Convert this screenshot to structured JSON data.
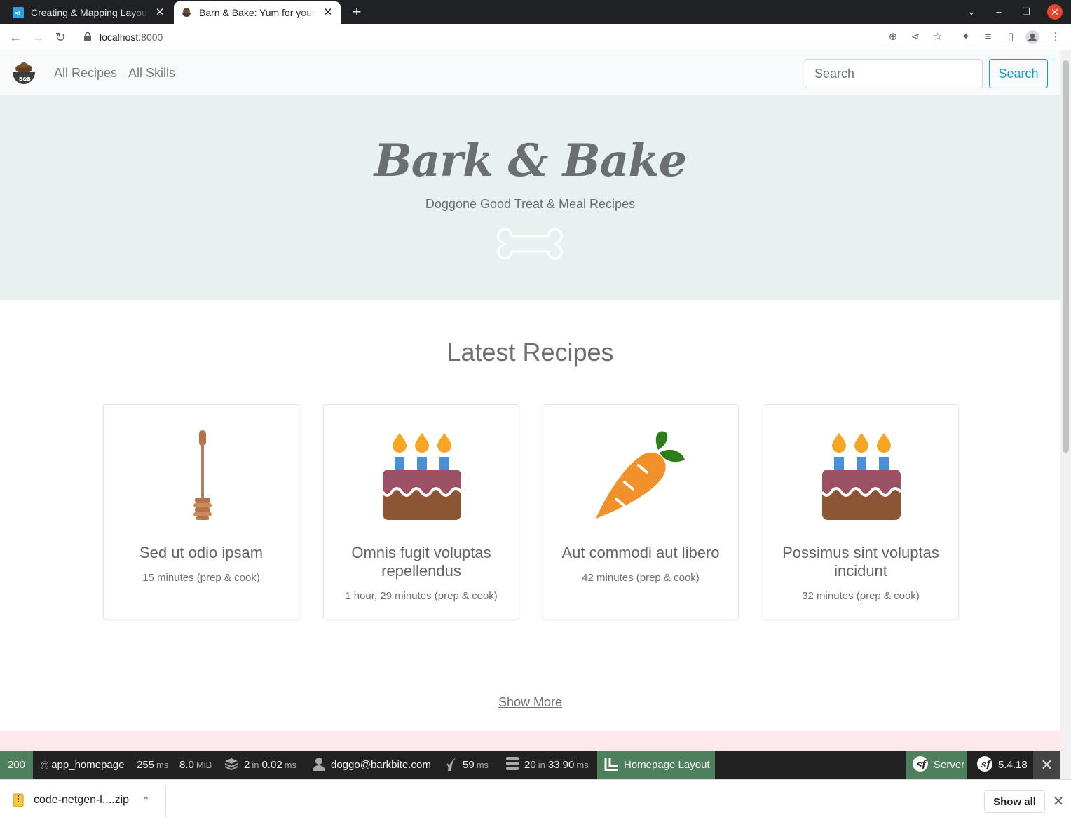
{
  "browser": {
    "tabs": [
      {
        "title": "Creating & Mapping Layou",
        "active": false,
        "favicon": "symfonycasts-icon"
      },
      {
        "title": "Barn & Bake: Yum for your",
        "active": true,
        "favicon": "bowl-logo-icon"
      }
    ],
    "url_host": "localhost",
    "url_port": ":8000"
  },
  "navbar": {
    "links": [
      "All Recipes",
      "All Skills"
    ],
    "search_placeholder": "Search",
    "search_button": "Search"
  },
  "hero": {
    "title": "Bark & Bake",
    "subtitle": "Doggone Good Treat & Meal Recipes",
    "icon": "bone-icon"
  },
  "latest": {
    "heading": "Latest Recipes",
    "cards": [
      {
        "title": "Sed ut odio ipsam",
        "meta": "15 minutes (prep & cook)",
        "icon": "honey-dipper-icon"
      },
      {
        "title": "Omnis fugit voluptas repellendus",
        "meta": "1 hour, 29 minutes (prep & cook)",
        "icon": "birthday-cake-icon"
      },
      {
        "title": "Aut commodi aut libero",
        "meta": "42 minutes (prep & cook)",
        "icon": "carrot-icon"
      },
      {
        "title": "Possimus sint voluptas incidunt",
        "meta": "32 minutes (prep & cook)",
        "icon": "birthday-cake-icon"
      }
    ],
    "show_more": "Show More"
  },
  "debug_toolbar": {
    "status": "200",
    "route": "app_homepage",
    "time_value": "255",
    "time_unit": "ms",
    "memory_value": "8.0",
    "memory_unit": "MiB",
    "cache_count": "2",
    "cache_in": "in",
    "cache_time": "0.02",
    "cache_unit": "ms",
    "user": "doggo@barkbite.com",
    "twig_time": "59",
    "twig_unit": "ms",
    "db_count": "20",
    "db_in": "in",
    "db_time": "33.90",
    "db_unit": "ms",
    "layout": "Homepage Layout",
    "server": "Server",
    "version": "5.4.18"
  },
  "downloads": {
    "file": "code-netgen-l....zip",
    "show_all": "Show all"
  },
  "colors": {
    "hero_bg": "#e6f1f0",
    "accent": "#17a2b8",
    "debug_green": "#4f805d"
  }
}
